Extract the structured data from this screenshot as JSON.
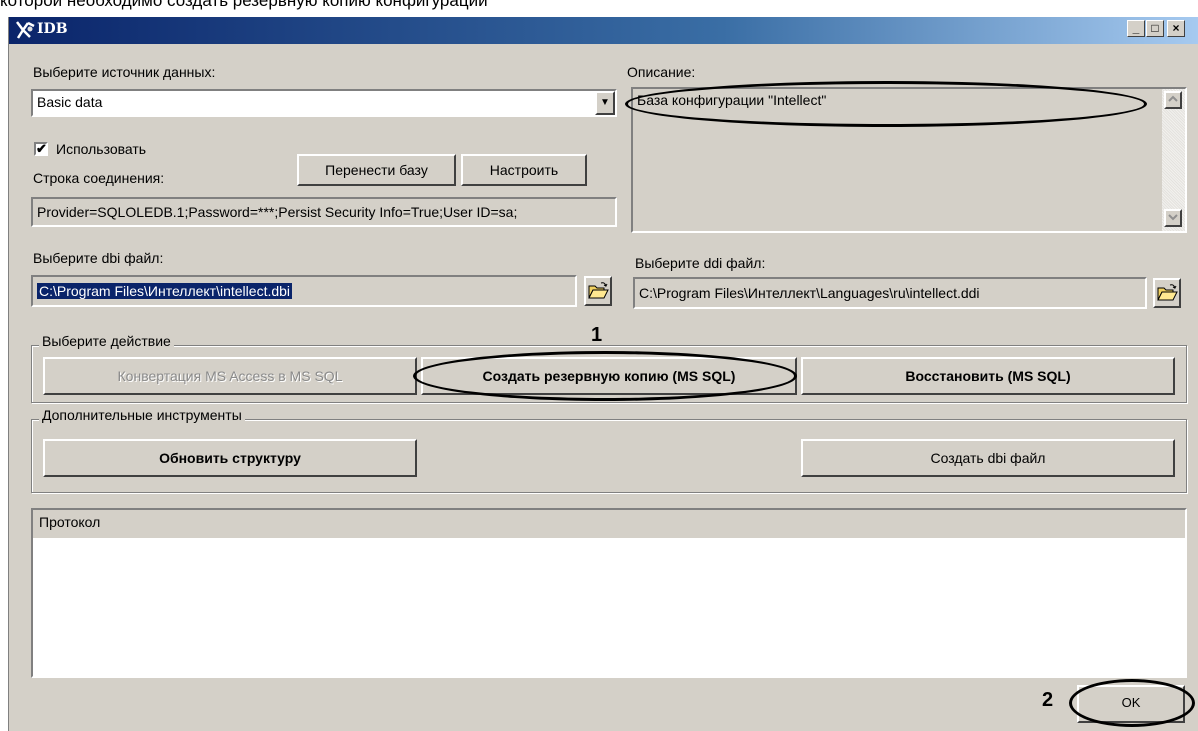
{
  "caption": "которой необходимо создать резервную копию конфигурации",
  "window": {
    "title": "IDB",
    "min_label": "_",
    "max_label": "□",
    "close_label": "×"
  },
  "source": {
    "label": "Выберите источник данных:",
    "value": "Basic data",
    "dropdown_arrow": "▼"
  },
  "use_checkbox": {
    "label": "Использовать",
    "checked_mark": "✔"
  },
  "connection": {
    "label": "Строка соединения:",
    "value": "Provider=SQLOLEDB.1;Password=***;Persist Security Info=True;User ID=sa;"
  },
  "buttons": {
    "move_db": "Перенести базу",
    "configure": "Настроить",
    "ok": "OK"
  },
  "description": {
    "label": "Описание:",
    "text": "База конфигурации \"Intellect\""
  },
  "dbi": {
    "label": "Выберите dbi файл:",
    "value": "C:\\Program Files\\Интеллект\\intellect.dbi"
  },
  "ddi": {
    "label": "Выберите ddi файл:",
    "value": "C:\\Program Files\\Интеллект\\Languages\\ru\\intellect.ddi"
  },
  "action_group": {
    "legend": "Выберите действие",
    "convert": "Конвертация MS Access в MS SQL",
    "backup": "Создать резервную копию  (MS SQL)",
    "restore": "Восстановить (MS SQL)"
  },
  "tools_group": {
    "legend": "Дополнительные инструменты",
    "update": "Обновить структуру",
    "create_dbi": "Создать dbi файл"
  },
  "log": {
    "header": "Протокол"
  },
  "annotations": {
    "step1": "1",
    "step2": "2"
  },
  "icons": {
    "folder": "folder-open-icon",
    "app": "idb-app-icon"
  }
}
